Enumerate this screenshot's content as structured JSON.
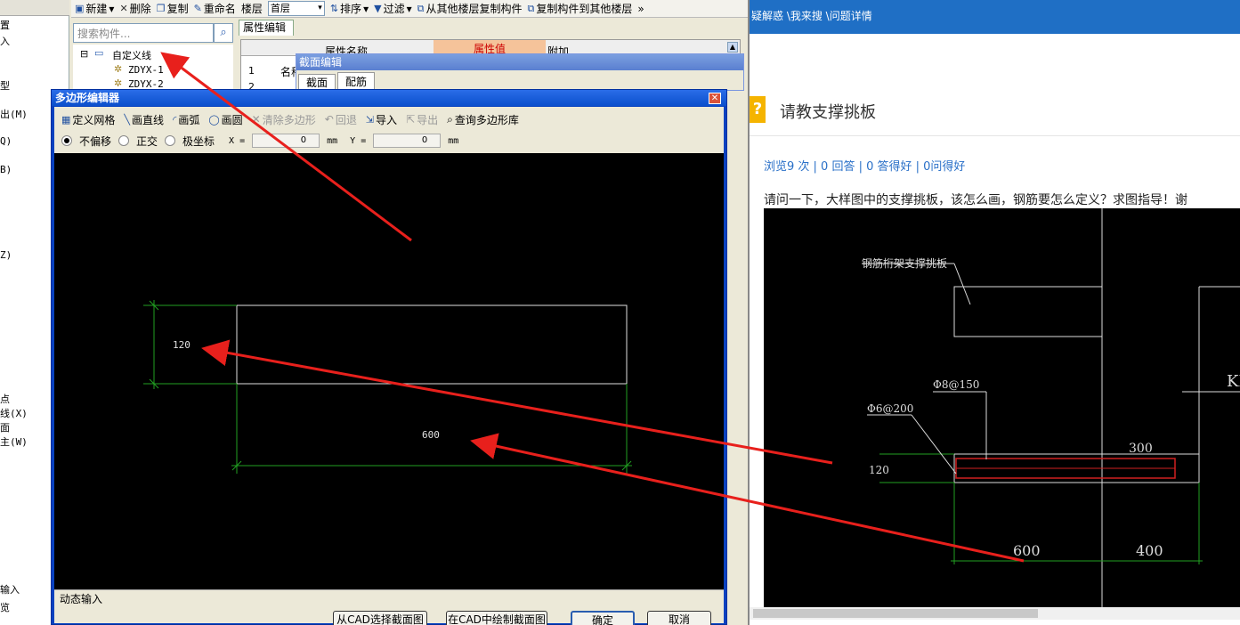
{
  "left_panel": {
    "rows": [
      "置",
      "入",
      "型",
      "出(M)",
      "Q)",
      "B)",
      "Z)",
      "点",
      "线(X)",
      "面",
      "主(W)",
      "输入",
      "览"
    ]
  },
  "toolbar": {
    "new_label": "新建",
    "delete_label": "删除",
    "copy_label": "复制",
    "rename_label": "重命名",
    "floor_label": "楼层",
    "floor_value": "首层",
    "sort_label": "排序",
    "filter_label": "过滤",
    "copy_from_label": "从其他楼层复制构件",
    "copy_to_label": "复制构件到其他楼层"
  },
  "search": {
    "placeholder": "搜索构件..."
  },
  "tree": {
    "root": "自定义线",
    "children": [
      "ZDYX-1",
      "ZDYX-2"
    ]
  },
  "props": {
    "tab": "属性编辑",
    "col_name": "属性名称",
    "col_value": "属性值",
    "col_extra": "附加",
    "row1_num": "1",
    "row1_name": "名称",
    "row2_num": "2"
  },
  "section_editor": {
    "title": "截面编辑",
    "tabs": [
      "截面",
      "配筋"
    ]
  },
  "dialog": {
    "title": "多边形编辑器",
    "tools": {
      "grid": "定义网格",
      "line": "画直线",
      "arc": "画弧",
      "circle": "画圆",
      "clear": "清除多边形",
      "undo": "回退",
      "import": "导入",
      "export": "导出",
      "query": "查询多边形库"
    },
    "options": {
      "no_offset": "不偏移",
      "ortho": "正交",
      "polar": "极坐标",
      "x_label": "X =",
      "x_value": "0",
      "y_label": "Y =",
      "y_value": "0",
      "unit": "mm"
    },
    "canvas": {
      "dim_height": "120",
      "dim_width": "600"
    },
    "status": "动态输入",
    "buttons": [
      "从CAD选择截面图",
      "在CAD中绘制截面图",
      "确定",
      "取消"
    ]
  },
  "right": {
    "breadcrumb": "疑解惑 \\我来搜 \\问题详情",
    "question_title": "请教支撑挑板",
    "stats": "浏览9 次 | 0 回答 | 0 答得好 | 0问得好",
    "body": "请问一下，大样图中的支撑挑板，该怎么画，钢筋要怎么定义？求图指导！谢",
    "drawing_labels": {
      "note": "钢筋桁架支撑挑板",
      "rebar1": "Φ8@150",
      "rebar2": "Φ6@200",
      "dim_300": "300",
      "dim_120": "120",
      "dim_600": "600",
      "dim_400": "400",
      "kl": "KL"
    }
  },
  "colors": {
    "arrow": "#e8201c",
    "title_bar": "#0b4fcc",
    "header_blue": "#1f6fc5",
    "link_blue": "#2a70c8"
  }
}
